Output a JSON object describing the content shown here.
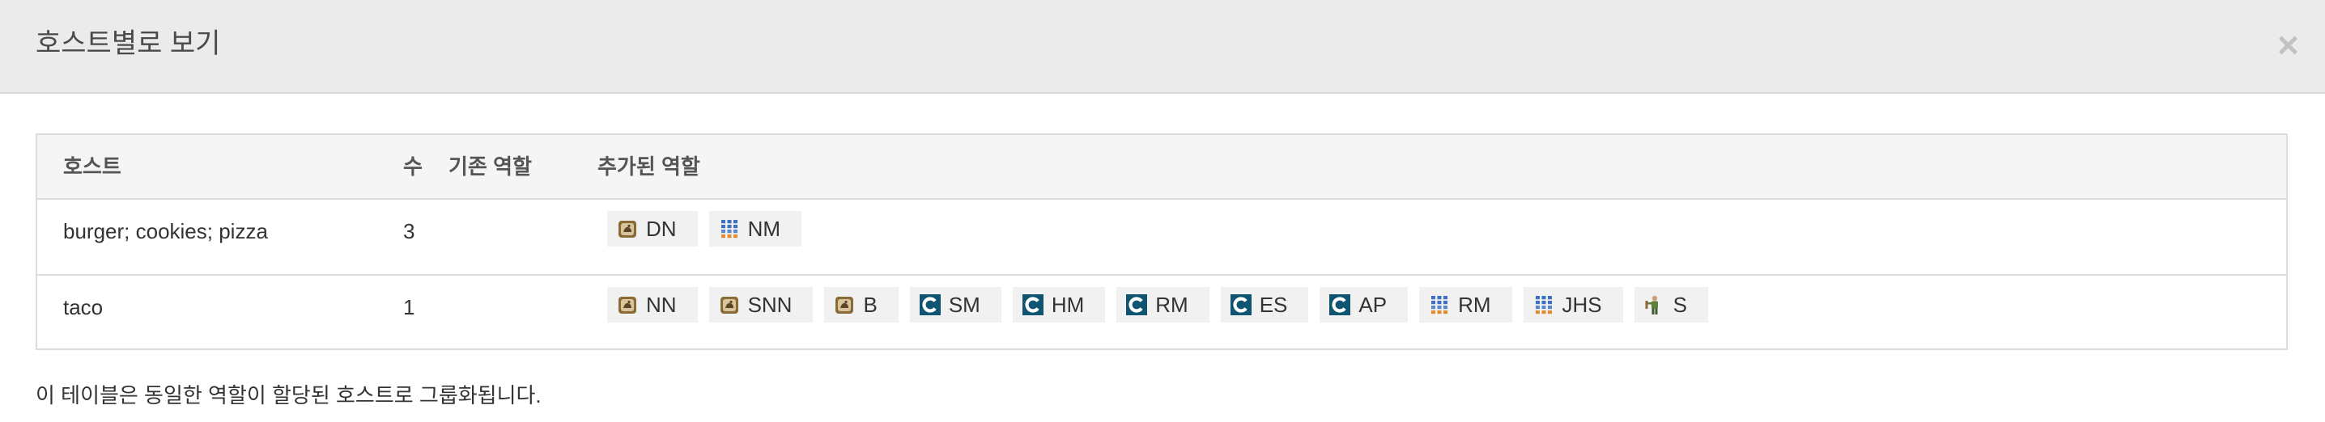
{
  "modal": {
    "title": "호스트별로 보기",
    "close_icon": "close-icon"
  },
  "table": {
    "headers": {
      "host": "호스트",
      "count": "수",
      "existing_roles": "기존 역할",
      "added_roles": "추가된 역할"
    },
    "rows": [
      {
        "host": "burger; cookies; pizza",
        "count": "3",
        "existing_roles": "",
        "added_roles": [
          {
            "label": "DN",
            "icon": "hdfs-icon"
          },
          {
            "label": "NM",
            "icon": "yarn-icon"
          }
        ]
      },
      {
        "host": "taco",
        "count": "1",
        "existing_roles": "",
        "added_roles": [
          {
            "label": "NN",
            "icon": "hdfs-icon"
          },
          {
            "label": "SNN",
            "icon": "hdfs-icon"
          },
          {
            "label": "B",
            "icon": "hdfs-icon"
          },
          {
            "label": "SM",
            "icon": "cloudera-icon"
          },
          {
            "label": "HM",
            "icon": "cloudera-icon"
          },
          {
            "label": "RM",
            "icon": "cloudera-icon"
          },
          {
            "label": "ES",
            "icon": "cloudera-icon"
          },
          {
            "label": "AP",
            "icon": "cloudera-icon"
          },
          {
            "label": "RM",
            "icon": "yarn-icon"
          },
          {
            "label": "JHS",
            "icon": "yarn-icon"
          },
          {
            "label": "S",
            "icon": "spark-icon"
          }
        ]
      }
    ]
  },
  "footer": {
    "note": "이 테이블은 동일한 역할이 할당된 호스트로 그룹화됩니다."
  }
}
